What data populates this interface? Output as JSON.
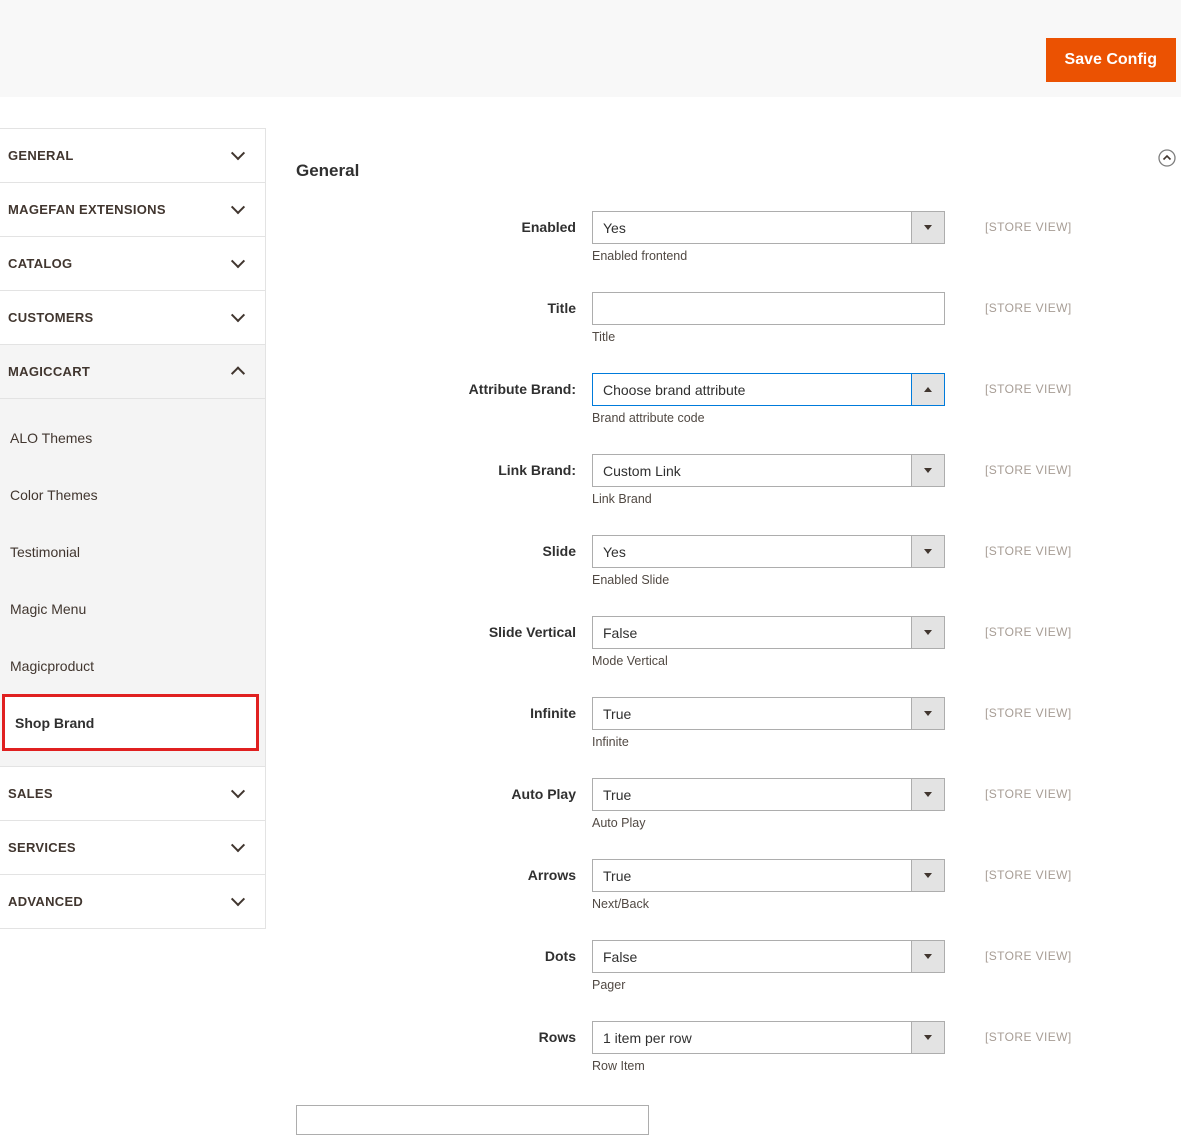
{
  "header": {
    "save_button": "Save Config",
    "accent_color": "#eb5202"
  },
  "sidebar": {
    "sections_top": [
      {
        "label": "GENERAL",
        "expanded": false
      },
      {
        "label": "MAGEFAN EXTENSIONS",
        "expanded": false
      },
      {
        "label": "CATALOG",
        "expanded": false
      },
      {
        "label": "CUSTOMERS",
        "expanded": false
      },
      {
        "label": "MAGICCART",
        "expanded": true
      }
    ],
    "subitems": [
      {
        "label": "ALO Themes",
        "selected": false
      },
      {
        "label": "Color Themes",
        "selected": false
      },
      {
        "label": "Testimonial",
        "selected": false
      },
      {
        "label": "Magic Menu",
        "selected": false
      },
      {
        "label": "Magicproduct",
        "selected": false
      },
      {
        "label": "Shop Brand",
        "selected": true
      }
    ],
    "sections_bottom": [
      {
        "label": "SALES",
        "expanded": false
      },
      {
        "label": "SERVICES",
        "expanded": false
      },
      {
        "label": "ADVANCED",
        "expanded": false
      }
    ],
    "highlight_color": "#e02020"
  },
  "main": {
    "section_title": "General",
    "collapse_icon": "chevron-up-circle",
    "focus_color": "#007bdb",
    "fields": [
      {
        "label": "Enabled",
        "type": "select",
        "value": "Yes",
        "helper": "Enabled frontend",
        "scope": "[STORE VIEW]",
        "arrow": "down",
        "focused": false
      },
      {
        "label": "Title",
        "type": "text",
        "value": "",
        "helper": "Title",
        "scope": "[STORE VIEW]"
      },
      {
        "label": "Attribute Brand:",
        "type": "select",
        "value": "Choose brand attribute",
        "helper": "Brand attribute code",
        "scope": "[STORE VIEW]",
        "arrow": "up",
        "focused": true
      },
      {
        "label": "Link Brand:",
        "type": "select",
        "value": "Custom Link",
        "helper": "Link Brand",
        "scope": "[STORE VIEW]",
        "arrow": "down",
        "focused": false
      },
      {
        "label": "Slide",
        "type": "select",
        "value": "Yes",
        "helper": "Enabled Slide",
        "scope": "[STORE VIEW]",
        "arrow": "down",
        "focused": false
      },
      {
        "label": "Slide Vertical",
        "type": "select",
        "value": "False",
        "helper": "Mode Vertical",
        "scope": "[STORE VIEW]",
        "arrow": "down",
        "focused": false
      },
      {
        "label": "Infinite",
        "type": "select",
        "value": "True",
        "helper": "Infinite",
        "scope": "[STORE VIEW]",
        "arrow": "down",
        "focused": false
      },
      {
        "label": "Auto Play",
        "type": "select",
        "value": "True",
        "helper": "Auto Play",
        "scope": "[STORE VIEW]",
        "arrow": "down",
        "focused": false
      },
      {
        "label": "Arrows",
        "type": "select",
        "value": "True",
        "helper": "Next/Back",
        "scope": "[STORE VIEW]",
        "arrow": "down",
        "focused": false
      },
      {
        "label": "Dots",
        "type": "select",
        "value": "False",
        "helper": "Pager",
        "scope": "[STORE VIEW]",
        "arrow": "down",
        "focused": false
      },
      {
        "label": "Rows",
        "type": "select",
        "value": "1 item per row",
        "helper": "Row Item",
        "scope": "[STORE VIEW]",
        "arrow": "down",
        "focused": false
      }
    ],
    "has_partial_next_field": true
  }
}
